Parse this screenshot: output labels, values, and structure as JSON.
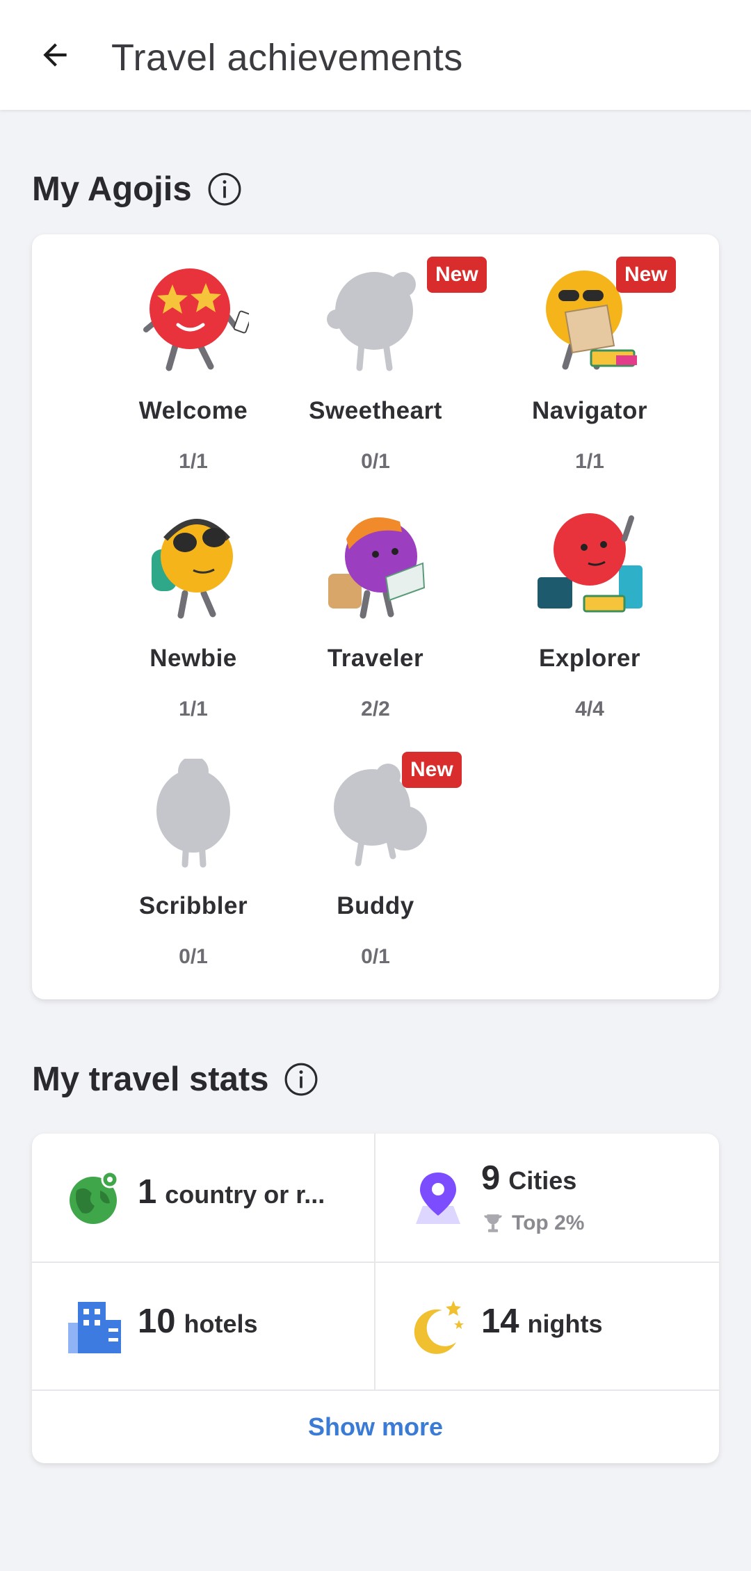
{
  "header": {
    "title": "Travel achievements",
    "back_icon": "arrow-left-icon"
  },
  "agojis_section": {
    "title": "My Agojis",
    "info_icon": "info-icon"
  },
  "agojis": [
    {
      "name": "Welcome",
      "count": "1/1",
      "badge": "",
      "unlocked": true,
      "color": "#e8323c"
    },
    {
      "name": "Sweetheart",
      "count": "0/1",
      "badge": "New",
      "unlocked": false,
      "color": "#c4c6cb"
    },
    {
      "name": "Navigator",
      "count": "1/1",
      "badge": "New",
      "unlocked": true,
      "color": "#f5b419"
    },
    {
      "name": "Newbie",
      "count": "1/1",
      "badge": "",
      "unlocked": true,
      "color": "#f5b419"
    },
    {
      "name": "Traveler",
      "count": "2/2",
      "badge": "",
      "unlocked": true,
      "color": "#9b3ec0"
    },
    {
      "name": "Explorer",
      "count": "4/4",
      "badge": "",
      "unlocked": true,
      "color": "#e8323c"
    },
    {
      "name": "Scribbler",
      "count": "0/1",
      "badge": "",
      "unlocked": false,
      "color": "#c4c6cb"
    },
    {
      "name": "Buddy",
      "count": "0/1",
      "badge": "New",
      "unlocked": false,
      "color": "#c4c6cb"
    }
  ],
  "stats_section": {
    "title": "My travel stats",
    "info_icon": "info-icon"
  },
  "stats": {
    "countries": {
      "number": "1",
      "label": "country or r...",
      "icon": "globe-icon",
      "color": "#3fa64a"
    },
    "cities": {
      "number": "9",
      "label": "Cities",
      "sub": "Top 2%",
      "icon": "map-pin-icon",
      "sub_icon": "trophy-icon",
      "color": "#7b4dff"
    },
    "hotels": {
      "number": "10",
      "label": "hotels",
      "icon": "building-icon",
      "color": "#3d7be0"
    },
    "nights": {
      "number": "14",
      "label": "nights",
      "icon": "moon-stars-icon",
      "color": "#f0c030"
    }
  },
  "show_more_label": "Show more"
}
